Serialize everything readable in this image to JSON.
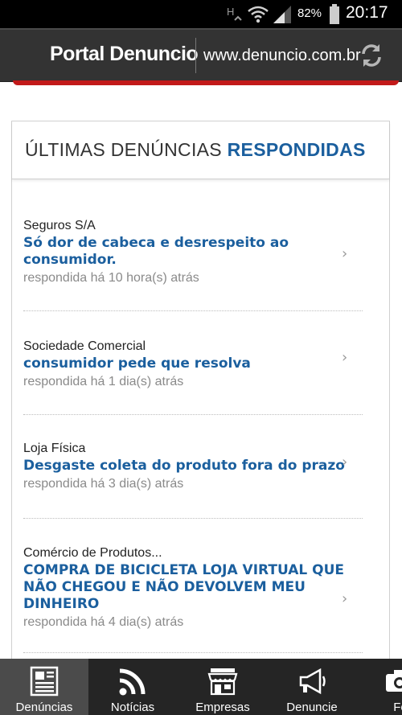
{
  "status_bar": {
    "battery": "82%",
    "time": "20:17"
  },
  "app_bar": {
    "brand": "Portal Denuncio",
    "url": "www.denuncio.com.br"
  },
  "card": {
    "title_part1": "ÚLTIMAS DENÚNCIAS",
    "title_part2": "RESPONDIDAS",
    "items": [
      {
        "company": "Seguros S/A",
        "title": "Só dor de cabeca e desrespeito ao consumidor.",
        "time": "respondida há 10 hora(s) atrás"
      },
      {
        "company": "Sociedade Comercial",
        "title": "consumidor pede que resolva",
        "time": "respondida há 1 dia(s) atrás"
      },
      {
        "company": "Loja Física",
        "title": "Desgaste coleta do produto fora do prazo",
        "time": "respondida há 3 dia(s) atrás"
      },
      {
        "company": "Comércio de Produtos...",
        "title": "COMPRA DE BICICLETA LOJA VIRTUAL QUE NÃO CHEGOU E NÃO DEVOLVEM MEU DINHEIRO",
        "time": "respondida há 4 dia(s) atrás"
      }
    ]
  },
  "bottom_nav": {
    "tabs": [
      {
        "label": "Denúncias",
        "icon": "newspaper-icon",
        "active": true
      },
      {
        "label": "Notícias",
        "icon": "rss-icon"
      },
      {
        "label": "Empresas",
        "icon": "store-icon"
      },
      {
        "label": "Denuncie",
        "icon": "megaphone-icon"
      },
      {
        "label": "Fo",
        "icon": "camera-icon"
      }
    ]
  },
  "colors": {
    "accent_blue": "#1b5f9e",
    "app_bar": "#333333",
    "red_stripe": "#c81818",
    "nav_bg": "#252525"
  }
}
